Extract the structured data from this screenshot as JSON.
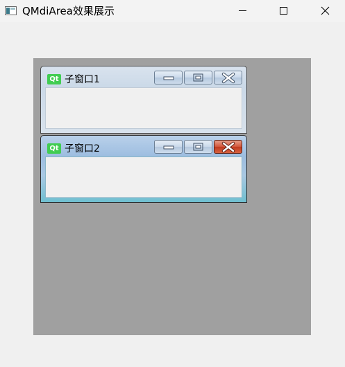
{
  "window": {
    "title": "QMdiArea效果展示"
  },
  "icons": {
    "app": "app-window-icon",
    "minimize": "minimize-icon",
    "maximize": "maximize-icon",
    "close": "close-icon",
    "qt_logo_text": "Qt"
  },
  "subwindows": [
    {
      "title": "子窗口1",
      "active": false
    },
    {
      "title": "子窗口2",
      "active": true
    }
  ],
  "colors": {
    "mdi_background": "#a0a0a0",
    "active_close": "#c03a1f",
    "qt_green": "#41cd52"
  }
}
